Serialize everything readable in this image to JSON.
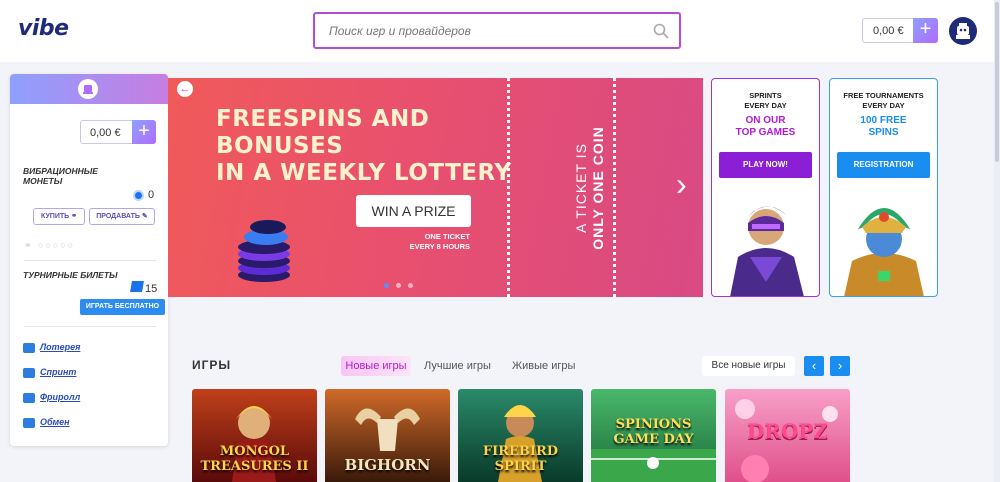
{
  "header": {
    "logo": "vibe",
    "search_placeholder": "Поиск игр и провайдеров",
    "balance": "0,00 €",
    "plus": "+"
  },
  "sidebar": {
    "balance": "0,00 €",
    "plus": "+",
    "vibration_coins_title": "ВИБРАЦИОННЫЕ МОНЕТЫ",
    "coins_count": "0",
    "buy_label": "КУПИТЬ",
    "sell_label": "ПРОДАВАТЬ",
    "tournament_title": "ТУРНИРНЫЕ БИЛЕТЫ",
    "tickets_count": "15",
    "play_free_label": "ИГРАТЬ БЕСПЛАТНО",
    "links": [
      {
        "label": "Лотерея",
        "icon": "lottery-icon"
      },
      {
        "label": "Спринт",
        "icon": "sprint-icon"
      },
      {
        "label": "Фриролл",
        "icon": "trophy-icon"
      },
      {
        "label": "Обмен",
        "icon": "exchange-icon"
      }
    ]
  },
  "banner": {
    "line1": "FREESPINS AND",
    "line2": "BONUSES",
    "line3": "IN A WEEKLY LOTTERY",
    "cta": "WIN A PRIZE",
    "sub1": "ONE TICKET",
    "sub2": "EVERY 8 HOURS",
    "side1": "A TICKET IS",
    "side2": "ONLY ONE COIN",
    "arrow": "›",
    "back": "←"
  },
  "promo_cards": [
    {
      "l1a": "SPRINTS",
      "l1b": "EVERY DAY",
      "l2a": "ON OUR",
      "l2b": "TOP GAMES",
      "button": "PLAY NOW!"
    },
    {
      "l1a": "FREE TOURNAMENTS",
      "l1b": "EVERY DAY",
      "l2a": "100 FREE",
      "l2b": "SPINS",
      "button": "REGISTRATION"
    }
  ],
  "games": {
    "title": "ИГРЫ",
    "tabs": [
      "Новые игры",
      "Лучшие игры",
      "Живые игры"
    ],
    "all_new": "Все новые игры",
    "prev": "‹",
    "next": "›",
    "tiles": [
      {
        "title": "MONGOL TREASURES II",
        "bg": "#7a1a0a"
      },
      {
        "title": "BIGHORN",
        "bg": "#5a2a14"
      },
      {
        "title": "FIREBIRD SPIRIT",
        "bg": "#1f5a3a"
      },
      {
        "title": "SPINIONS GAME DAY",
        "bg": "#2f8a4a"
      },
      {
        "title": "DROPZ",
        "bg": "#e05a9a"
      }
    ]
  },
  "colors": {
    "accent_purple": "#b24bd8",
    "accent_blue": "#1a8df0",
    "navy": "#1f2a7a"
  }
}
